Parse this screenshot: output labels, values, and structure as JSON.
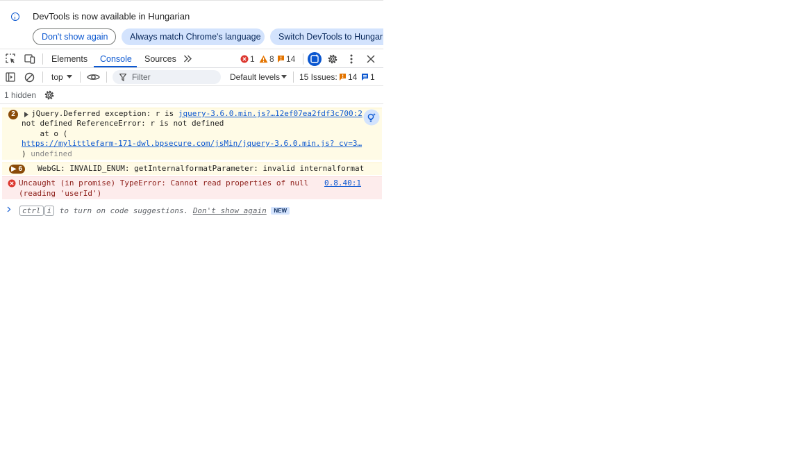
{
  "infobar": {
    "title": "DevTools is now available in Hungarian",
    "buttons": [
      "Don't show again",
      "Always match Chrome's language",
      "Switch DevTools to Hungari"
    ]
  },
  "tabs": {
    "items": [
      "Elements",
      "Console",
      "Sources"
    ],
    "active": "Console",
    "errors": "1",
    "warnings": "8",
    "issues": "14"
  },
  "toolbar": {
    "context": "top",
    "filter_placeholder": "Filter",
    "levels": "Default levels",
    "issues_label": "15 Issues:",
    "issues_warn": "14",
    "issues_info": "1"
  },
  "hidden": {
    "label": "1 hidden"
  },
  "messages": {
    "m1": {
      "count": "2",
      "line1": "jQuery.Deferred exception: r is ",
      "source": "jquery-3.6.0.min.js?…12ef07ea2fdf3c700:2",
      "line2": "not defined ReferenceError: r is not defined",
      "line3": "    at o (",
      "url": "https://mylittlefarm-171-dwl.bpsecure.com/jsMin/jquery-3.6.0.min.js? cv=3…",
      "line4": ") ",
      "undefined": "undefined"
    },
    "m2": {
      "count": "6",
      "text": "WebGL: INVALID_ENUM: getInternalformatParameter: invalid internalformat"
    },
    "m3": {
      "line1": "Uncaught (in promise) TypeError: Cannot read properties of null",
      "line2": "(reading 'userId')",
      "source": "0.8.40:1"
    }
  },
  "prompt": {
    "key1": "ctrl",
    "key2": "i",
    "text": " to turn on code suggestions. ",
    "dismiss": "Don't show again",
    "badge": "NEW"
  },
  "colors": {
    "accent": "#0b57d0",
    "warning_bg": "#fffbe6",
    "error_bg": "#fdecec",
    "error_icon": "#dc362e",
    "warning_icon": "#e37400"
  }
}
